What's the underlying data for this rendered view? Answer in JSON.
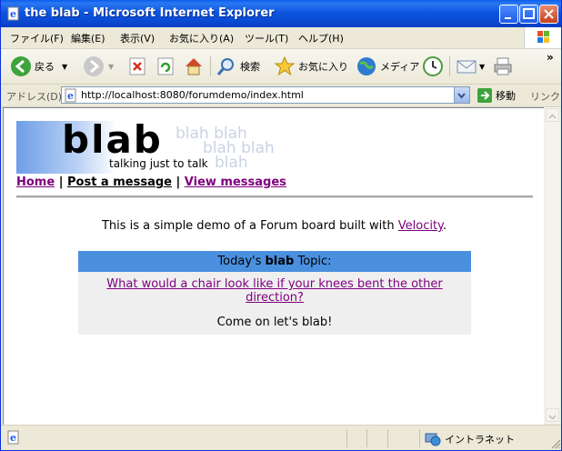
{
  "window": {
    "title": "the blab - Microsoft Internet Explorer",
    "menu": [
      "ファイル(F)",
      "編集(E)",
      "表示(V)",
      "お気に入り(A)",
      "ツール(T)",
      "ヘルプ(H)"
    ],
    "toolbar": {
      "back": "戻る",
      "search": "検索",
      "favorites": "お気に入り",
      "media": "メディア"
    },
    "address": {
      "label": "アドレス(D)",
      "url": "http://localhost:8080/forumdemo/index.html",
      "go": "移動",
      "links": "リンク"
    },
    "status": {
      "zone": "イントラネット"
    }
  },
  "page": {
    "logo": "blab",
    "tagline": "talking just to talk",
    "background_words": [
      "blah blah",
      "blah blah",
      "blah"
    ],
    "nav": {
      "home": "Home",
      "post": "Post a message",
      "view": "View messages",
      "sep": "|"
    },
    "intro_prefix": "This is a simple demo of a Forum board built with ",
    "intro_link": "Velocity",
    "intro_suffix": ".",
    "topic": {
      "head_prefix": "Today's ",
      "head_bold": "blab",
      "head_suffix": " Topic:",
      "question": "What would a chair look like if your knees bent the other direction?",
      "cta": "Come on let's blab!"
    }
  },
  "colors": {
    "titlebar": "#0A49D2",
    "topic_header": "#4A90DF",
    "topic_body": "#EFEFEF",
    "visited_link": "#800080"
  }
}
